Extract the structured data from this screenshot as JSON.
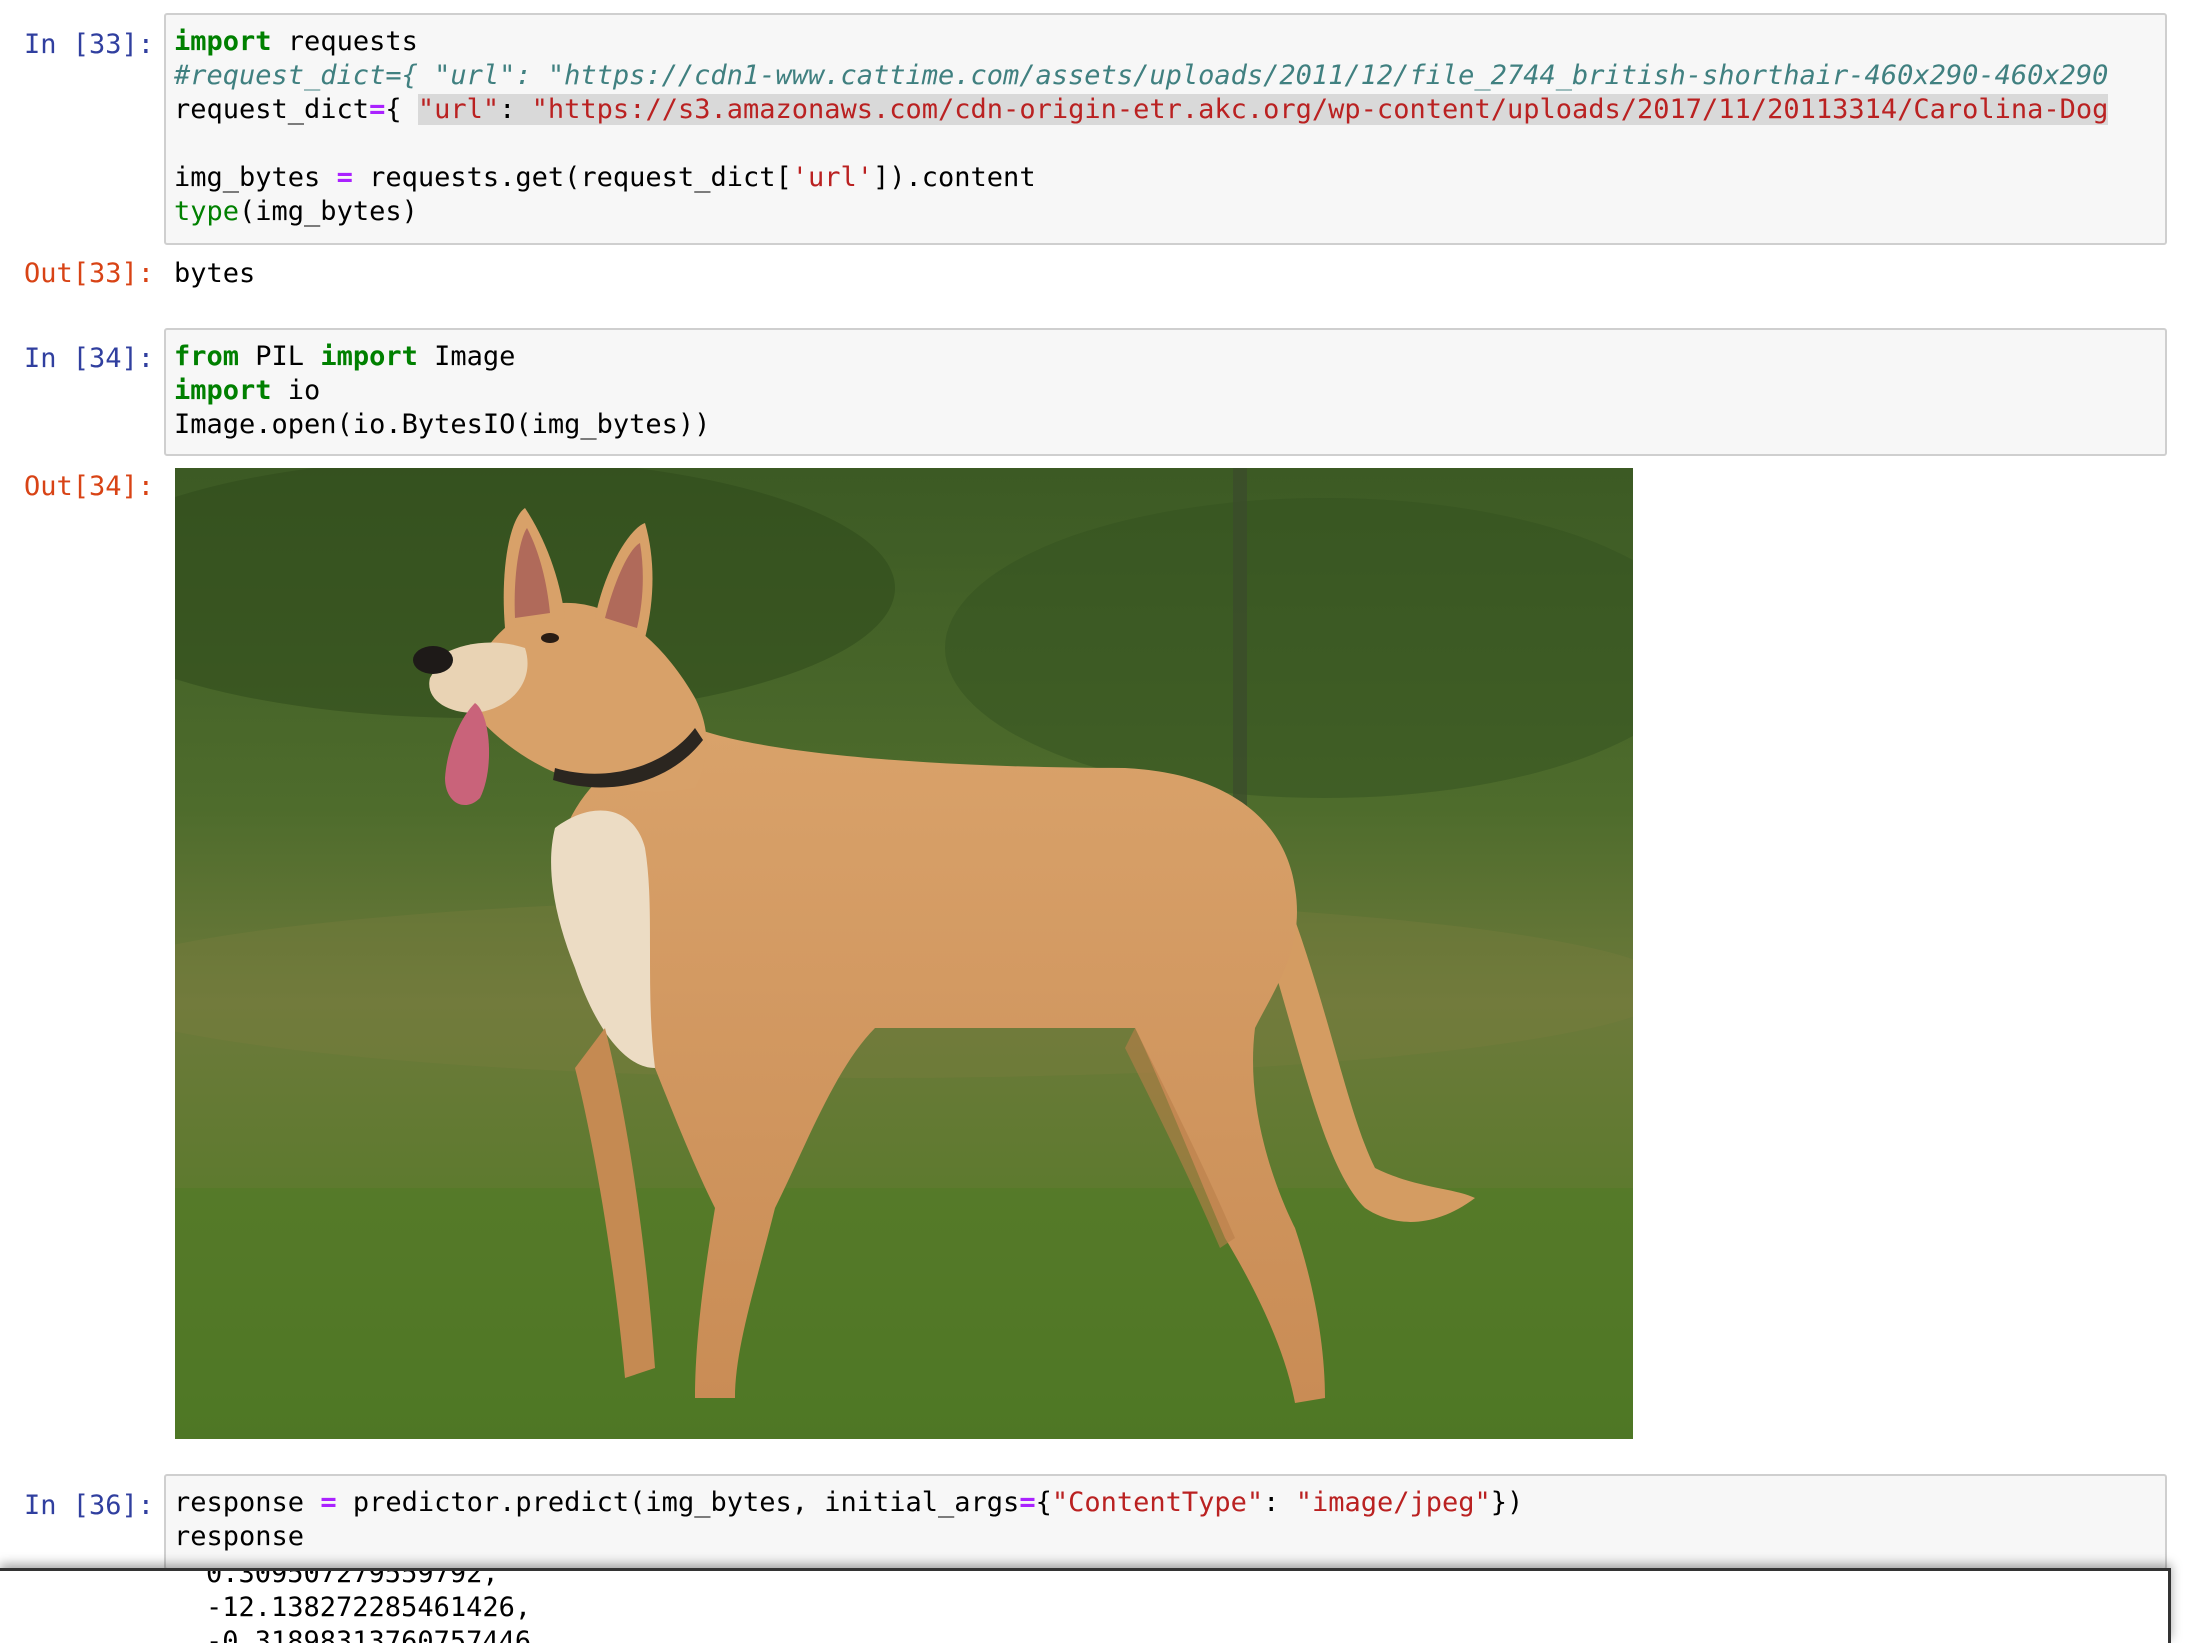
{
  "cell33": {
    "in_prompt": "In [33]:",
    "code": {
      "l1_kw": "import",
      "l1_rest": " requests",
      "l2_comment": "#request_dict={ \"url\": \"https://cdn1-www.cattime.com/assets/uploads/2011/12/file_2744_british-shorthair-460x290-460x290",
      "l3_name": "request_dict",
      "l3_op": "=",
      "l3_brace": "{ ",
      "l3_key": "\"url\"",
      "l3_colon": ": ",
      "l3_val": "\"https://s3.amazonaws.com/cdn-origin-etr.akc.org/wp-content/uploads/2017/11/20113314/Carolina-Dog",
      "l5_a": "img_bytes ",
      "l5_op": "=",
      "l5_b": " requests.get(request_dict[",
      "l5_str": "'url'",
      "l5_c": "]).content",
      "l6_bi": "type",
      "l6_rest": "(img_bytes)"
    },
    "out_prompt": "Out[33]:",
    "output": "bytes"
  },
  "cell34": {
    "in_prompt": "In [34]:",
    "code": {
      "l1_kw1": "from",
      "l1_mod": " PIL ",
      "l1_kw2": "import",
      "l1_name": " Image",
      "l2_kw": "import",
      "l2_rest": " io",
      "l3": "Image.open(io.BytesIO(img_bytes))"
    },
    "out_prompt": "Out[34]:"
  },
  "cell36": {
    "in_prompt": "In [36]:",
    "code": {
      "l1_a": "response ",
      "l1_op1": "=",
      "l1_b": " predictor.predict(img_bytes, initial_args",
      "l1_op2": "=",
      "l1_c": "{",
      "l1_key": "\"ContentType\"",
      "l1_colon": ": ",
      "l1_val": "\"image/jpeg\"",
      "l1_d": "})",
      "l2": "response"
    }
  },
  "scroll_output": {
    "partial_line": "0.309507279559792,",
    "line1": "-12.138272285461426,",
    "line2": "-0.31898313760757446,"
  }
}
